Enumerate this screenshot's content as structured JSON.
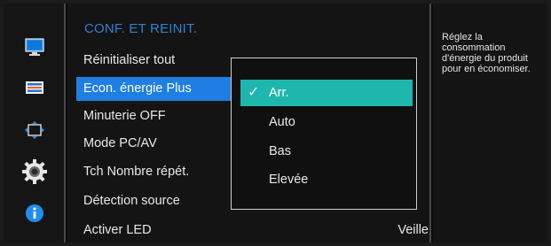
{
  "menu": {
    "title": "CONF. ET REINIT.",
    "items": [
      {
        "label": "Réinitialiser tout"
      },
      {
        "label": "Econ. énergie Plus"
      },
      {
        "label": "Minuterie OFF"
      },
      {
        "label": "Mode PC/AV"
      },
      {
        "label": "Tch Nombre répét."
      },
      {
        "label": "Détection source"
      },
      {
        "label": "Activer LED",
        "value": "Veille"
      }
    ],
    "active_index": 1
  },
  "submenu": {
    "items": [
      {
        "label": "Arr."
      },
      {
        "label": "Auto"
      },
      {
        "label": "Bas"
      },
      {
        "label": "Elevée"
      }
    ],
    "selected_index": 0
  },
  "help": {
    "text": "Réglez la consommation d'énergie du produit pour en économiser."
  },
  "icons": {
    "items": [
      "monitor-icon",
      "color-bars-icon",
      "size-position-icon",
      "gear-icon",
      "info-icon"
    ]
  },
  "colors": {
    "title_blue": "#2f7fd6",
    "active_blue": "#1f7ee2",
    "selected_teal": "#1fb6ae"
  }
}
